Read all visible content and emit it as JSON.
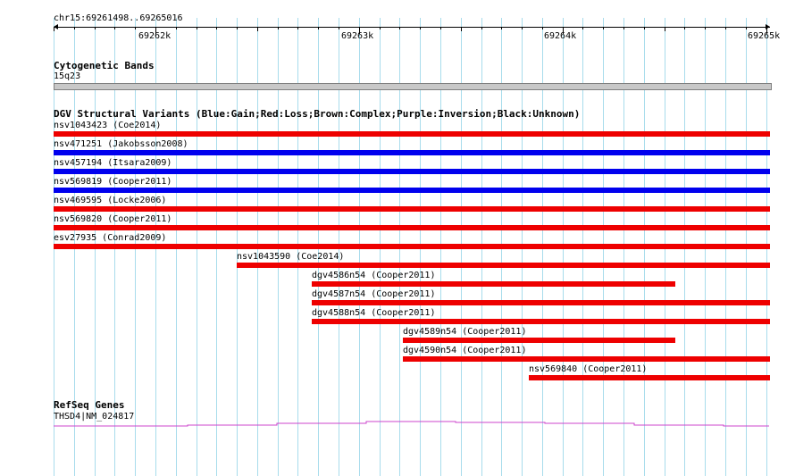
{
  "ruler": {
    "location": "chr15:69261498..69265016",
    "ticks": [
      "69262k",
      "69263k",
      "69264k",
      "69265k"
    ]
  },
  "cytoband": {
    "title": "Cytogenetic Bands",
    "band": "15q23",
    "color": "#c8c8c8"
  },
  "dgv": {
    "title": "DGV Structural Variants (Blue:Gain;Red:Loss;Brown:Complex;Purple:Inversion;Black:Unknown)",
    "colors": {
      "gain": "#0000ee",
      "loss": "#ee0000"
    },
    "variants": [
      {
        "label": "nsv1043423 (Coe2014)",
        "type": "loss"
      },
      {
        "label": "nsv471251 (Jakobsson2008)",
        "type": "gain"
      },
      {
        "label": "nsv457194 (Itsara2009)",
        "type": "gain"
      },
      {
        "label": "nsv569819 (Cooper2011)",
        "type": "gain"
      },
      {
        "label": "nsv469595 (Locke2006)",
        "type": "loss"
      },
      {
        "label": "nsv569820 (Cooper2011)",
        "type": "loss"
      },
      {
        "label": "esv27935 (Conrad2009)",
        "type": "loss"
      },
      {
        "label": "nsv1043590 (Coe2014)",
        "type": "loss"
      },
      {
        "label": "dgv4586n54 (Cooper2011)",
        "type": "loss"
      },
      {
        "label": "dgv4587n54 (Cooper2011)",
        "type": "loss"
      },
      {
        "label": "dgv4588n54 (Cooper2011)",
        "type": "loss"
      },
      {
        "label": "dgv4589n54 (Cooper2011)",
        "type": "loss"
      },
      {
        "label": "dgv4590n54 (Cooper2011)",
        "type": "loss"
      },
      {
        "label": "nsv569840 (Cooper2011)",
        "type": "loss"
      }
    ]
  },
  "refseq": {
    "title": "RefSeq Genes",
    "gene_label": "THSD4|NM_024817",
    "color": "#cc44cc"
  },
  "colors": {
    "gridline": "#a8dcec"
  }
}
